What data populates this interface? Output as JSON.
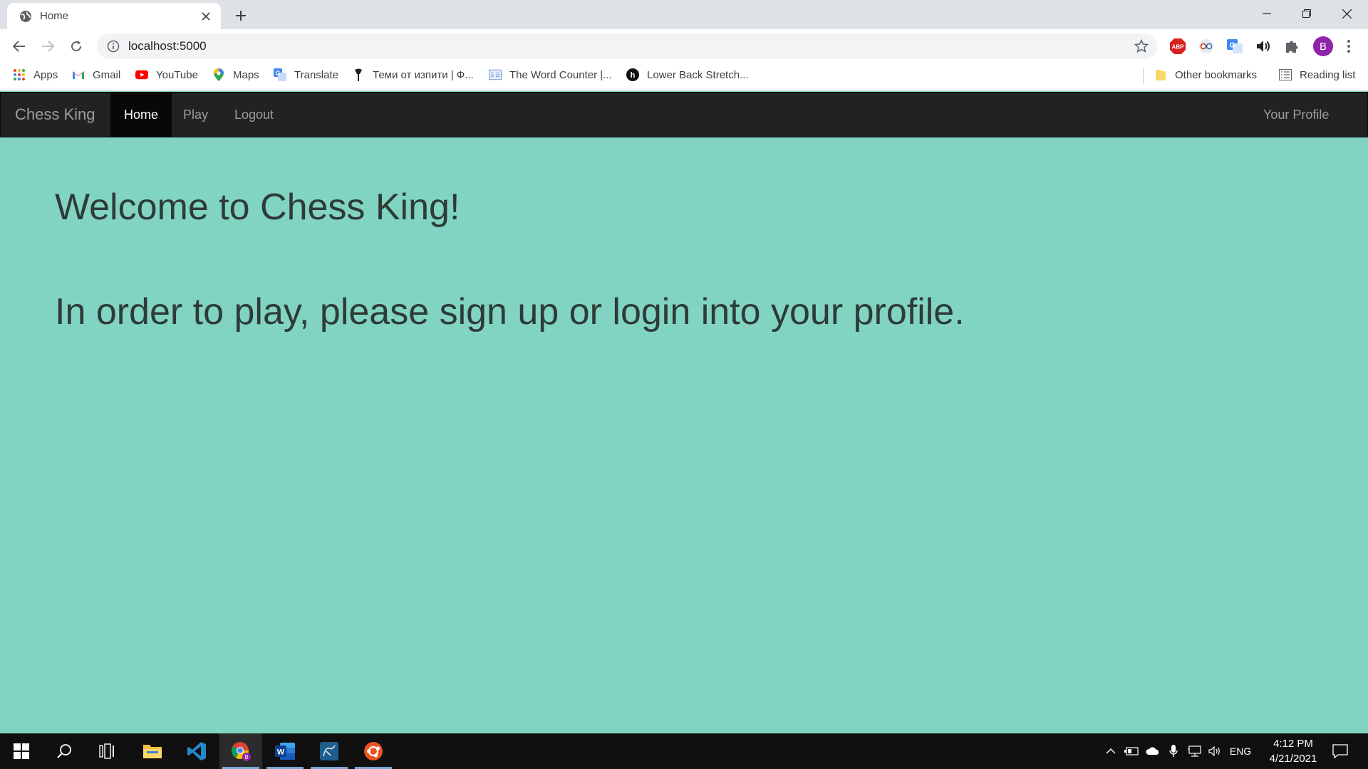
{
  "browser": {
    "tab_title": "Home",
    "url": "localhost:5000",
    "profile_initial": "B",
    "bookmarks": [
      {
        "label": "Apps"
      },
      {
        "label": "Gmail"
      },
      {
        "label": "YouTube"
      },
      {
        "label": "Maps"
      },
      {
        "label": "Translate"
      },
      {
        "label": "Теми от изпити | Ф..."
      },
      {
        "label": "The Word Counter |..."
      },
      {
        "label": "Lower Back Stretch..."
      }
    ],
    "other_bookmarks": "Other bookmarks",
    "reading_list": "Reading list",
    "extensions": [
      "adblock-plus-icon",
      "reader-extension-icon",
      "google-translate-icon",
      "volume-icon",
      "extensions-puzzle-icon"
    ]
  },
  "app": {
    "brand": "Chess King",
    "nav": {
      "home": "Home",
      "play": "Play",
      "logout": "Logout",
      "profile": "Your Profile"
    },
    "headline": "Welcome to Chess King!",
    "message": "In order to play, please sign up or login into your profile.",
    "colors": {
      "background": "#82d4c2",
      "navbar": "#222222",
      "active_nav": "#080808",
      "text": "#2e3b37"
    }
  },
  "taskbar": {
    "language": "ENG",
    "time": "4:12 PM",
    "date": "4/21/2021",
    "apps": [
      "windows-start-icon",
      "search-icon",
      "task-view-icon",
      "file-explorer-icon",
      "vscode-icon",
      "chrome-icon",
      "word-icon",
      "mysql-workbench-icon",
      "ubuntu-icon"
    ]
  }
}
